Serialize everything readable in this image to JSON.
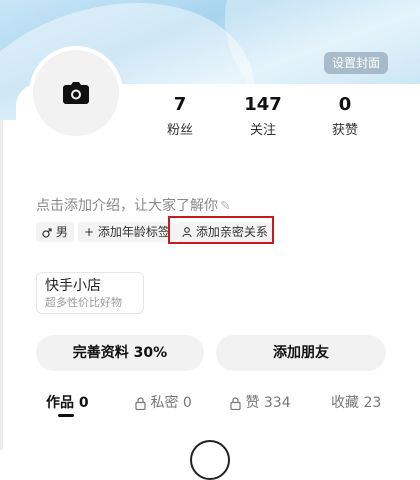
{
  "cover": {
    "set_cover_label": "设置封面"
  },
  "stats": [
    {
      "value": "7",
      "label": "粉丝"
    },
    {
      "value": "147",
      "label": "关注"
    },
    {
      "value": "0",
      "label": "获赞"
    }
  ],
  "intro": {
    "text": "点击添加介绍，让大家了解你"
  },
  "tags": {
    "gender": "男",
    "add_age": "添加年龄标签",
    "add_relation": "添加亲密关系"
  },
  "shop": {
    "title": "快手小店",
    "subtitle": "超多性价比好物"
  },
  "buttons": {
    "complete_profile": "完善资料 30%",
    "add_friend": "添加朋友"
  },
  "tabs": [
    {
      "label": "作品 0",
      "active": true
    },
    {
      "label": "私密 0",
      "locked": true
    },
    {
      "label": "赞 334",
      "locked": true
    },
    {
      "label": "收藏 23"
    }
  ],
  "colors": {
    "highlight_box": "#c8191e",
    "cover_gradient": "#a8d4ee"
  },
  "icons": {
    "avatar": "camera-icon",
    "intro_edit": "pencil-icon",
    "gender": "male-icon",
    "add_age": "plus-icon",
    "relation": "person-icon",
    "lock": "lock-icon"
  }
}
